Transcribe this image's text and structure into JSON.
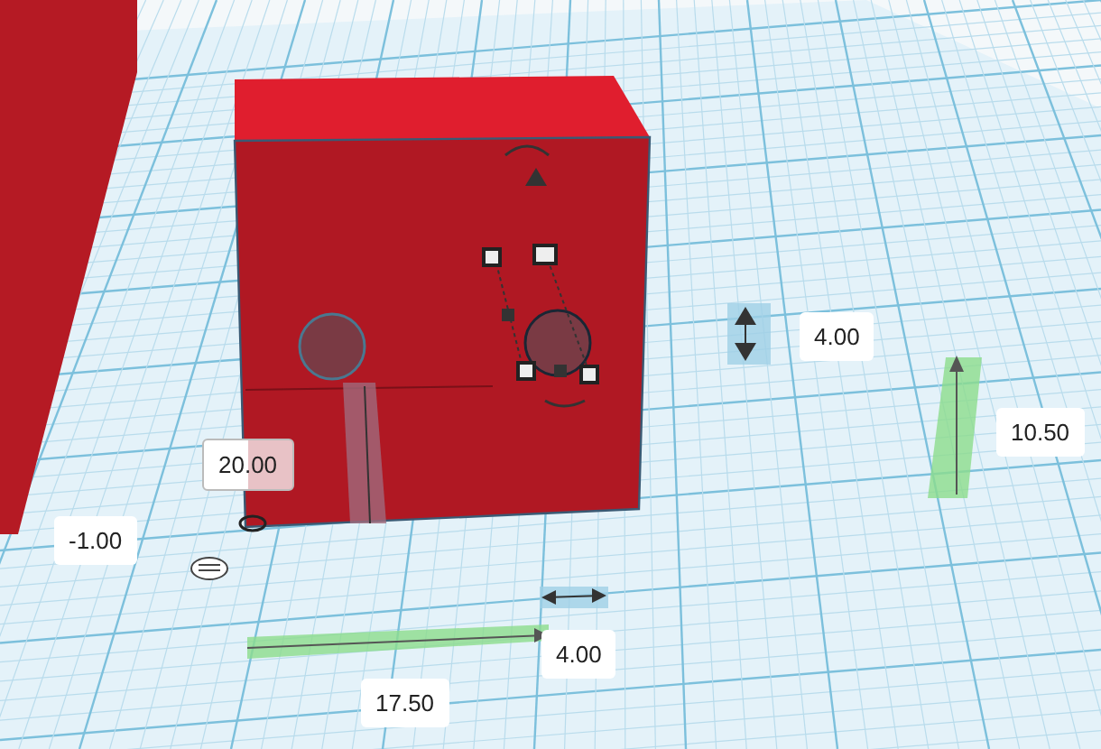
{
  "dimension_fields": [
    {
      "value": "4.00",
      "active": false
    },
    {
      "value": "10.50",
      "active": false
    },
    {
      "value": "20.00",
      "active": true
    },
    {
      "value": "-1.00",
      "active": false
    },
    {
      "value": "4.00",
      "active": false
    },
    {
      "value": "17.50",
      "active": false
    }
  ]
}
